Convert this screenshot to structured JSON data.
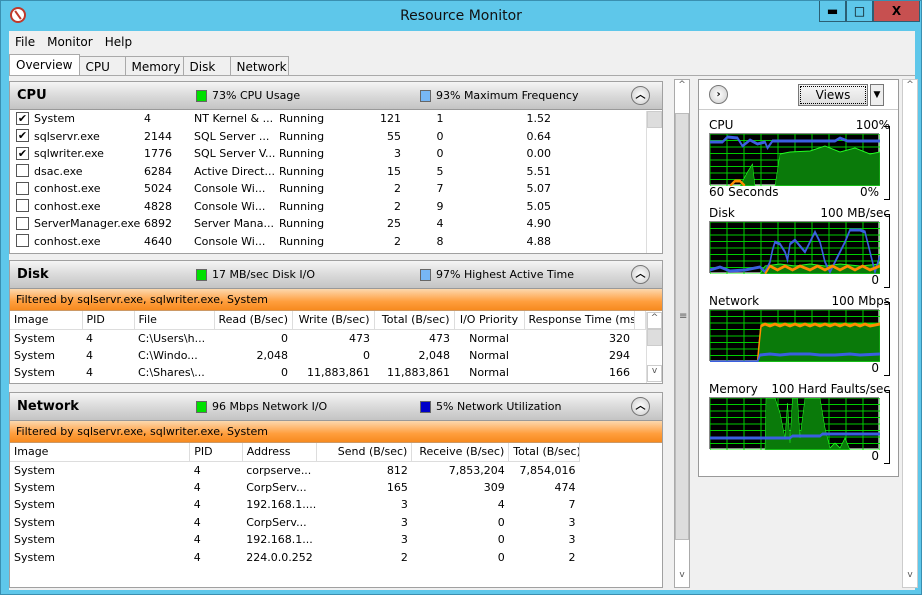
{
  "window": {
    "title": "Resource Monitor"
  },
  "menu": [
    "File",
    "Monitor",
    "Help"
  ],
  "tabs": [
    "Overview",
    "CPU",
    "Memory",
    "Disk",
    "Network"
  ],
  "active_tab": "Overview",
  "cpu": {
    "title": "CPU",
    "indicator1": {
      "text": "73% CPU Usage",
      "color": "#00e000"
    },
    "indicator2": {
      "text": "93% Maximum Frequency",
      "color": "#77b7f5"
    },
    "rows": [
      {
        "checked": true,
        "image": "System",
        "pid": "4",
        "description": "NT Kernel & ...",
        "status": "Running",
        "threads": "121",
        "cpu": "1",
        "avg_cpu": "1.52"
      },
      {
        "checked": true,
        "image": "sqlservr.exe",
        "pid": "2144",
        "description": "SQL Server ...",
        "status": "Running",
        "threads": "55",
        "cpu": "0",
        "avg_cpu": "0.64"
      },
      {
        "checked": true,
        "image": "sqlwriter.exe",
        "pid": "1776",
        "description": "SQL Server V...",
        "status": "Running",
        "threads": "3",
        "cpu": "0",
        "avg_cpu": "0.00"
      },
      {
        "checked": false,
        "image": "dsac.exe",
        "pid": "6284",
        "description": "Active Direct...",
        "status": "Running",
        "threads": "15",
        "cpu": "5",
        "avg_cpu": "5.51"
      },
      {
        "checked": false,
        "image": "conhost.exe",
        "pid": "5024",
        "description": "Console Wi...",
        "status": "Running",
        "threads": "2",
        "cpu": "7",
        "avg_cpu": "5.07"
      },
      {
        "checked": false,
        "image": "conhost.exe",
        "pid": "4828",
        "description": "Console Wi...",
        "status": "Running",
        "threads": "2",
        "cpu": "9",
        "avg_cpu": "5.05"
      },
      {
        "checked": false,
        "image": "ServerManager.exe",
        "pid": "6892",
        "description": "Server Mana...",
        "status": "Running",
        "threads": "25",
        "cpu": "4",
        "avg_cpu": "4.90"
      },
      {
        "checked": false,
        "image": "conhost.exe",
        "pid": "4640",
        "description": "Console Wi...",
        "status": "Running",
        "threads": "2",
        "cpu": "8",
        "avg_cpu": "4.88"
      }
    ]
  },
  "disk": {
    "title": "Disk",
    "indicator1": {
      "text": "17 MB/sec Disk I/O",
      "color": "#00e000"
    },
    "indicator2": {
      "text": "97% Highest Active Time",
      "color": "#77b7f5"
    },
    "filter": "Filtered by sqlservr.exe, sqlwriter.exe, System",
    "columns": [
      "Image",
      "PID",
      "File",
      "Read (B/sec)",
      "Write (B/sec)",
      "Total (B/sec)",
      "I/O Priority",
      "Response Time (ms)"
    ],
    "rows": [
      [
        "System",
        "4",
        "C:\\Users\\h...",
        "0",
        "473",
        "473",
        "Normal",
        "320"
      ],
      [
        "System",
        "4",
        "C:\\Windo...",
        "2,048",
        "0",
        "2,048",
        "Normal",
        "294"
      ],
      [
        "System",
        "4",
        "C:\\Shares\\...",
        "0",
        "11,883,861",
        "11,883,861",
        "Normal",
        "166"
      ]
    ]
  },
  "network": {
    "title": "Network",
    "indicator1": {
      "text": "96 Mbps Network I/O",
      "color": "#00e000"
    },
    "indicator2": {
      "text": "5% Network Utilization",
      "color": "#0000c8"
    },
    "filter": "Filtered by sqlservr.exe, sqlwriter.exe, System",
    "columns": [
      "Image",
      "PID",
      "Address",
      "Send (B/sec)",
      "Receive (B/sec)",
      "Total (B/sec)"
    ],
    "rows": [
      [
        "System",
        "4",
        "corpserve...",
        "812",
        "7,853,204",
        "7,854,016"
      ],
      [
        "System",
        "4",
        "CorpServ...",
        "165",
        "309",
        "474"
      ],
      [
        "System",
        "4",
        "192.168.1....",
        "3",
        "4",
        "7"
      ],
      [
        "System",
        "4",
        "CorpServ...",
        "3",
        "0",
        "3"
      ],
      [
        "System",
        "4",
        "192.168.1...",
        "3",
        "0",
        "3"
      ],
      [
        "System",
        "4",
        "224.0.0.252",
        "2",
        "0",
        "2"
      ]
    ]
  },
  "right_panel": {
    "views_label": "Views",
    "graphs": [
      {
        "name": "CPU",
        "max": "100%",
        "min": "0%",
        "time": "60 Seconds"
      },
      {
        "name": "Disk",
        "max": "100 MB/sec",
        "min": "0"
      },
      {
        "name": "Network",
        "max": "100 Mbps",
        "min": "0"
      },
      {
        "name": "Memory",
        "max": "100 Hard Faults/sec",
        "min": "0"
      }
    ]
  }
}
